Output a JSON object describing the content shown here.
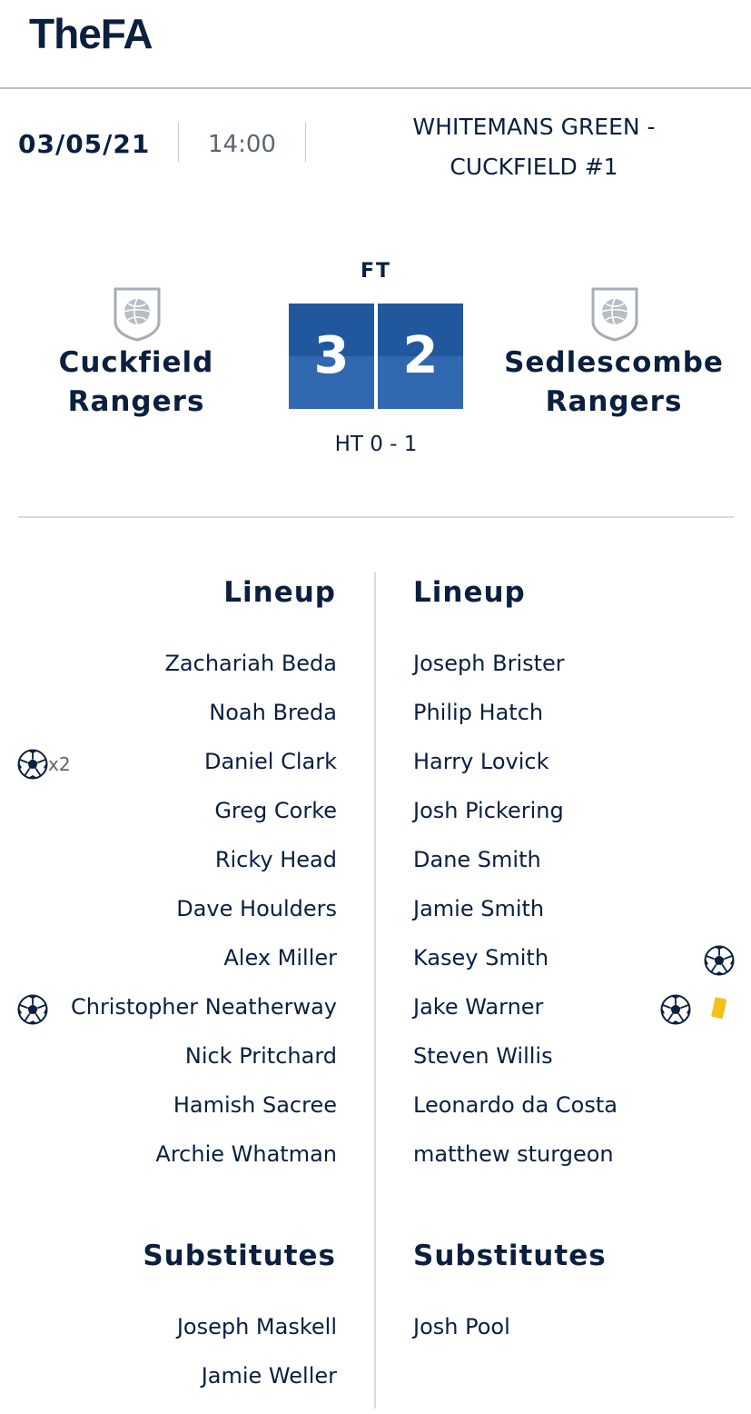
{
  "header": {
    "logo_text": "TheFA"
  },
  "match_info": {
    "date": "03/05/21",
    "time": "14:00",
    "venue_line1": "WHITEMANS GREEN -",
    "venue_line2": "CUCKFIELD #1"
  },
  "score": {
    "status": "FT",
    "home_score": "3",
    "away_score": "2",
    "half_time": "HT 0 - 1",
    "colors": {
      "score_top": "#21589d",
      "score_bottom": "#3169b1"
    }
  },
  "teams": {
    "home": {
      "name_line1": "Cuckfield",
      "name_line2": "Rangers"
    },
    "away": {
      "name_line1": "Sedlescombe",
      "name_line2": "Rangers"
    }
  },
  "home": {
    "lineup_title": "Lineup",
    "lineup": [
      {
        "name": "Zachariah Beda",
        "goals": 0
      },
      {
        "name": "Noah Breda",
        "goals": 0
      },
      {
        "name": "Daniel Clark",
        "goals": 2,
        "goal_count_label": "x2"
      },
      {
        "name": "Greg Corke",
        "goals": 0
      },
      {
        "name": "Ricky Head",
        "goals": 0
      },
      {
        "name": "Dave Houlders",
        "goals": 0
      },
      {
        "name": "Alex Miller",
        "goals": 0
      },
      {
        "name": "Christopher Neatherway",
        "goals": 1
      },
      {
        "name": "Nick Pritchard",
        "goals": 0
      },
      {
        "name": "Hamish Sacree",
        "goals": 0
      },
      {
        "name": "Archie Whatman",
        "goals": 0
      }
    ],
    "subs_title": "Substitutes",
    "subs": [
      "Joseph Maskell",
      "Jamie Weller"
    ]
  },
  "away": {
    "lineup_title": "Lineup",
    "lineup": [
      {
        "name": "Joseph Brister",
        "goals": 0
      },
      {
        "name": "Philip Hatch",
        "goals": 0
      },
      {
        "name": "Harry Lovick",
        "goals": 0
      },
      {
        "name": "Josh Pickering",
        "goals": 0
      },
      {
        "name": "Dane Smith",
        "goals": 0
      },
      {
        "name": "Jamie Smith",
        "goals": 0
      },
      {
        "name": "Kasey Smith",
        "goals": 1
      },
      {
        "name": "Jake Warner",
        "goals": 1,
        "yellow_card": true
      },
      {
        "name": "Steven Willis",
        "goals": 0
      },
      {
        "name": "Leonardo da Costa",
        "goals": 0
      },
      {
        "name": "matthew sturgeon",
        "goals": 0
      }
    ],
    "subs_title": "Substitutes",
    "subs": [
      "Josh Pool"
    ]
  },
  "icons": {
    "goal": "football-icon",
    "card": "yellow-card-icon",
    "crest": "club-crest-icon"
  }
}
